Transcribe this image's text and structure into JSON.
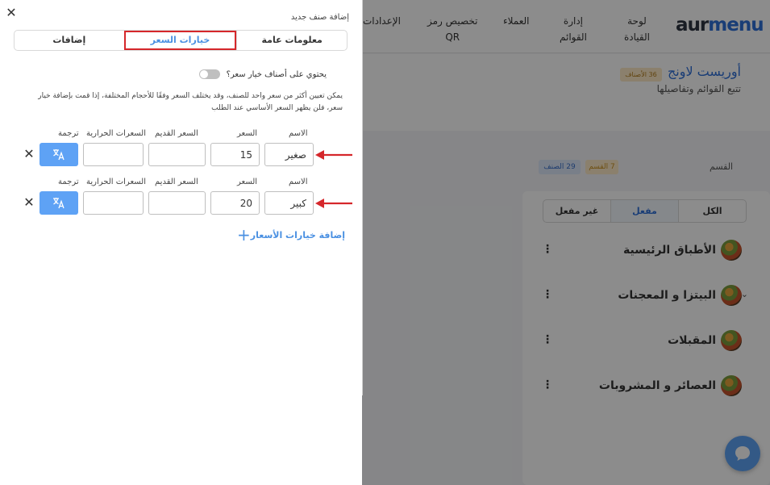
{
  "app": {
    "logo": {
      "part1": "aur",
      "part2": "menu"
    },
    "nav": [
      {
        "label": "لوحة\nالقيادة"
      },
      {
        "label": "إدارة\nالقوائم"
      },
      {
        "label": "العملاء"
      },
      {
        "label": "تخصيص رمز\nQR"
      },
      {
        "label": "الإعدادات"
      }
    ],
    "page": {
      "title": "أوريست لاونج",
      "badge": "36 الأصناف",
      "subtitle": "تتبع القوائم وتفاصيلها"
    },
    "section_label": "القسم",
    "section_pills": {
      "sections": "7 القسم",
      "items": "29 الصنف"
    },
    "filter_tabs": [
      {
        "label": "الكل"
      },
      {
        "label": "مفعل"
      },
      {
        "label": "غير مفعل"
      }
    ],
    "categories": [
      {
        "name": "الأطباق الرئيسية"
      },
      {
        "name": "البيتزا و المعجنات"
      },
      {
        "name": "المقبلات"
      },
      {
        "name": "العصائر و المشروبات"
      }
    ]
  },
  "drawer": {
    "title": "إضافة صنف جديد",
    "tabs": [
      {
        "label": "معلومات عامة"
      },
      {
        "label": "خيارات السعر"
      },
      {
        "label": "إضافات"
      }
    ],
    "toggle_label": "يحتوي على أصناف خيار سعر؟",
    "info": "يمكن تعيين أكثر من سعر واحد للصنف، وقد يختلف السعر وفقًا للأحجام المختلفة، إذا قمت بإضافة خيار سعر، فلن يظهر السعر الأساسي عند الطلب",
    "headers": {
      "name": "الاسم",
      "price": "السعر",
      "old_price": "السعر القديم",
      "calories": "السعرات الحرارية",
      "translate": "ترجمة"
    },
    "rows": [
      {
        "name": "صغير",
        "price": "15",
        "old_price": "",
        "calories": ""
      },
      {
        "name": "كبير",
        "price": "20",
        "old_price": "",
        "calories": ""
      }
    ],
    "add_link": "إضافة خيارات الأسعار"
  },
  "colors": {
    "accent": "#4a90e2",
    "highlight_box": "#d5272b",
    "arrow": "#d5272b",
    "translate_button": "#5ea2f5"
  }
}
